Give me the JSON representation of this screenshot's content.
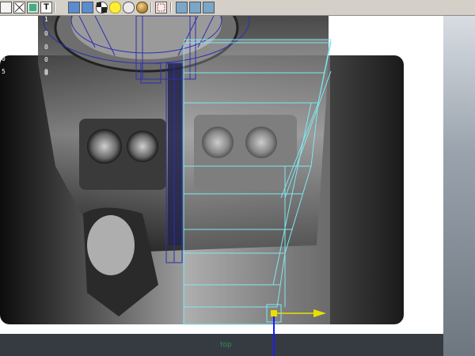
{
  "toolbar": {
    "buttons": [
      {
        "icon": "select-icon"
      },
      {
        "icon": "wireframe-icon"
      },
      {
        "icon": "smooth-shade-icon"
      },
      {
        "icon": "text-icon"
      },
      {
        "icon": "camera-icon"
      },
      {
        "icon": "camera-alt-icon"
      },
      {
        "icon": "checker-icon"
      },
      {
        "icon": "light-icon"
      },
      {
        "icon": "shade-ball-icon"
      },
      {
        "icon": "isolate-icon"
      },
      {
        "icon": "grid-icon"
      },
      {
        "icon": "stats-icon"
      },
      {
        "icon": "share-icon"
      }
    ],
    "text_glyph": "T"
  },
  "viewport": {
    "label": "top",
    "col_numbers": [
      "1",
      "0",
      "0",
      "0",
      "0",
      "0"
    ],
    "side_numbers": [
      "0",
      "5"
    ],
    "colors": {
      "wire_cyan": "#7fe8f0",
      "wire_blue": "#2d2fb0",
      "handle_yellow": "#e8e000",
      "axis_blue": "#1a1aff",
      "label_green": "#2e8b57"
    }
  }
}
